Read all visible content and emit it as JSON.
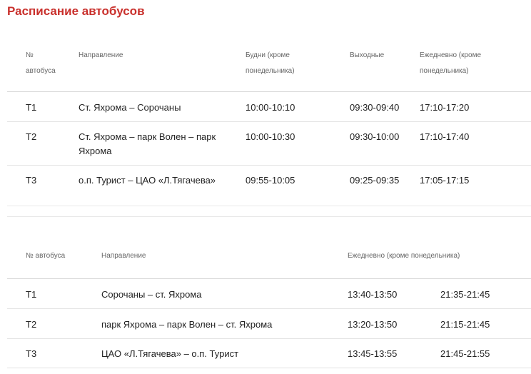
{
  "page": {
    "title": "Расписание автобусов"
  },
  "table1": {
    "headers": {
      "number": "№ автобуса",
      "direction": "Направление",
      "weekdays": "Будни (кроме понедельника)",
      "weekends": "Выходные",
      "daily": "Ежедневно (кроме понедельника)"
    },
    "rows": [
      {
        "number": "Т1",
        "direction": "Ст. Яхрома – Сорочаны",
        "weekdays": "10:00-10:10",
        "weekends": "09:30-09:40",
        "daily": "17:10-17:20"
      },
      {
        "number": "Т2",
        "direction": "Ст. Яхрома – парк Волен – парк Яхрома",
        "weekdays": "10:00-10:30",
        "weekends": "09:30-10:00",
        "daily": "17:10-17:40"
      },
      {
        "number": "Т3",
        "direction": "о.п. Турист – ЦАО «Л.Тягачева»",
        "weekdays": "09:55-10:05",
        "weekends": "09:25-09:35",
        "daily": "17:05-17:15"
      }
    ]
  },
  "table2": {
    "headers": {
      "number": "№ автобуса",
      "direction": "Направление",
      "daily": "Ежедневно (кроме понедельника)"
    },
    "rows": [
      {
        "number": "Т1",
        "direction": "Сорочаны – ст. Яхрома",
        "time1": "13:40-13:50",
        "time2": "21:35-21:45"
      },
      {
        "number": "Т2",
        "direction": "парк Яхрома – парк Волен – ст. Яхрома",
        "time1": "13:20-13:50",
        "time2": "21:15-21:45"
      },
      {
        "number": "Т3",
        "direction": "ЦАО «Л.Тягачева» – о.п. Турист",
        "time1": "13:45-13:55",
        "time2": "21:45-21:55"
      }
    ]
  }
}
